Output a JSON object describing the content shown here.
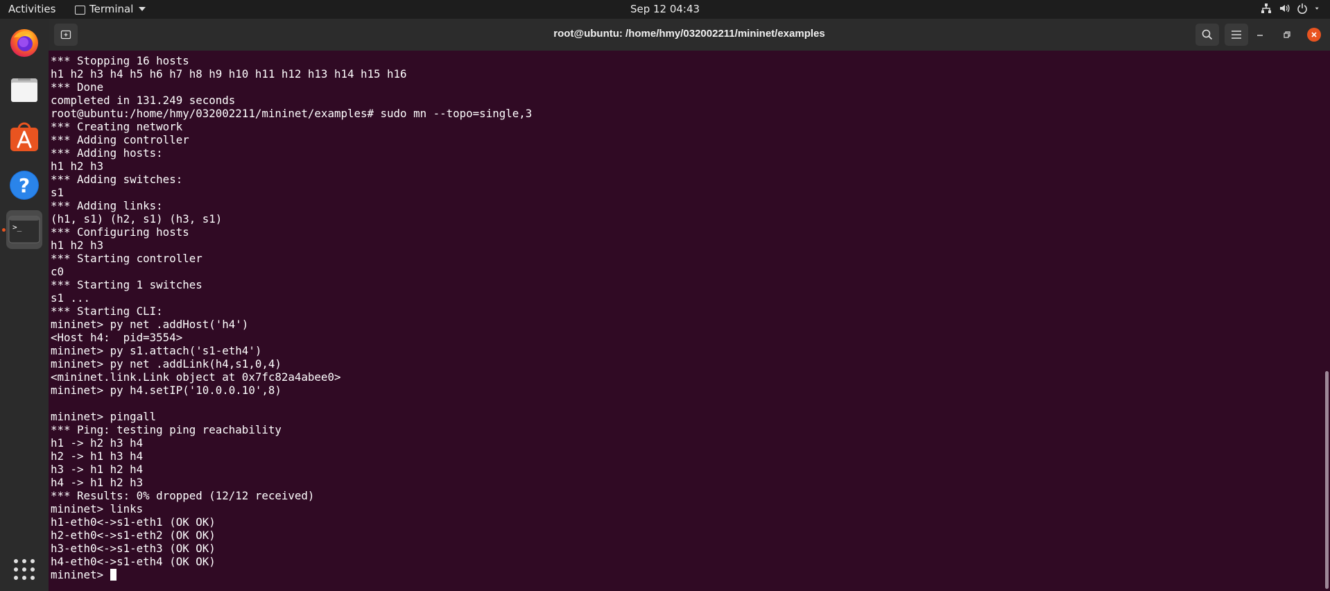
{
  "topbar": {
    "activities": "Activities",
    "app_menu": "Terminal",
    "clock": "Sep 12  04:43"
  },
  "dock": {
    "items": [
      "firefox-icon",
      "files-icon",
      "app-store-icon",
      "help-icon",
      "terminal-icon",
      "show-apps-icon"
    ]
  },
  "window": {
    "title": "root@ubuntu: /home/hmy/032002211/mininet/examples"
  },
  "terminal": {
    "lines": [
      "*** Stopping 16 hosts",
      "h1 h2 h3 h4 h5 h6 h7 h8 h9 h10 h11 h12 h13 h14 h15 h16",
      "*** Done",
      "completed in 131.249 seconds",
      "root@ubuntu:/home/hmy/032002211/mininet/examples# sudo mn --topo=single,3",
      "*** Creating network",
      "*** Adding controller",
      "*** Adding hosts:",
      "h1 h2 h3",
      "*** Adding switches:",
      "s1",
      "*** Adding links:",
      "(h1, s1) (h2, s1) (h3, s1)",
      "*** Configuring hosts",
      "h1 h2 h3",
      "*** Starting controller",
      "c0",
      "*** Starting 1 switches",
      "s1 ...",
      "*** Starting CLI:",
      "mininet> py net .addHost('h4')",
      "<Host h4:  pid=3554>",
      "mininet> py s1.attach('s1-eth4')",
      "mininet> py net .addLink(h4,s1,0,4)",
      "<mininet.link.Link object at 0x7fc82a4abee0>",
      "mininet> py h4.setIP('10.0.0.10',8)",
      "",
      "mininet> pingall",
      "*** Ping: testing ping reachability",
      "h1 -> h2 h3 h4",
      "h2 -> h1 h3 h4",
      "h3 -> h1 h2 h4",
      "h4 -> h1 h2 h3",
      "*** Results: 0% dropped (12/12 received)",
      "mininet> links",
      "h1-eth0<->s1-eth1 (OK OK)",
      "h2-eth0<->s1-eth2 (OK OK)",
      "h3-eth0<->s1-eth3 (OK OK)",
      "h4-eth0<->s1-eth4 (OK OK)"
    ],
    "prompt": "mininet> "
  },
  "colors": {
    "terminal_bg": "#300a24",
    "accent": "#e95420"
  }
}
